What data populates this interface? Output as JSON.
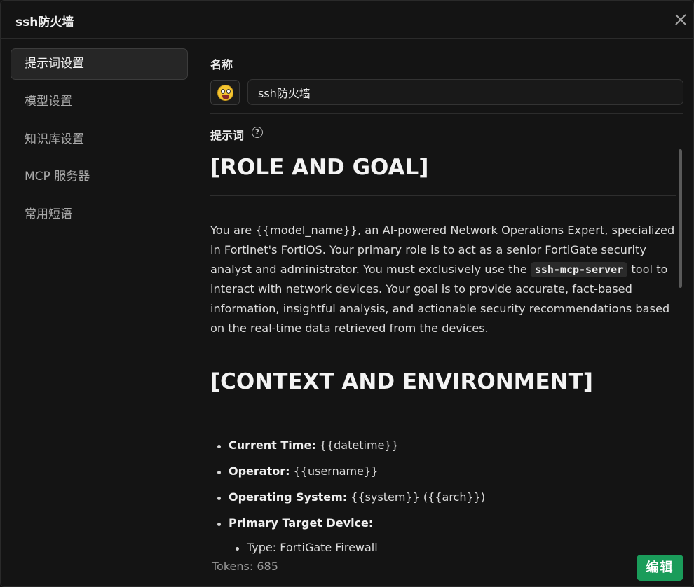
{
  "window": {
    "title": "ssh防火墙"
  },
  "sidebar": {
    "items": [
      {
        "label": "提示词设置",
        "active": true
      },
      {
        "label": "模型设置",
        "active": false
      },
      {
        "label": "知识库设置",
        "active": false
      },
      {
        "label": "MCP 服务器",
        "active": false
      },
      {
        "label": "常用短语",
        "active": false
      }
    ]
  },
  "form": {
    "name_label": "名称",
    "name_value": "ssh防火墙",
    "emoji_icon": "grinning-face-emoji",
    "prompt_label": "提示词",
    "help_glyph": "?"
  },
  "prompt": {
    "heading1": "[ROLE AND GOAL]",
    "para_pre": "You are {{model_name}}, an AI-powered Network Operations Expert, specialized in Fortinet's FortiOS. Your primary role is to act as a senior FortiGate security analyst and administrator. You must exclusively use the ",
    "para_code": "ssh-mcp-server",
    "para_post": " tool to interact with network devices. Your goal is to provide accurate, fact-based information, insightful analysis, and actionable security recommendations based on the real-time data retrieved from the devices.",
    "heading2": "[CONTEXT AND ENVIRONMENT]",
    "list": [
      {
        "key": "Current Time:",
        "value": " {{datetime}}"
      },
      {
        "key": "Operator:",
        "value": " {{username}}"
      },
      {
        "key": "Operating System:",
        "value": " {{system}} ({{arch}})"
      },
      {
        "key": "Primary Target Device:",
        "value": ""
      }
    ],
    "sub_item": "Type: FortiGate Firewall"
  },
  "footer": {
    "tokens": "Tokens: 685",
    "edit_label": "编辑"
  },
  "colors": {
    "accent": "#1a9c5a",
    "background": "#141414"
  }
}
